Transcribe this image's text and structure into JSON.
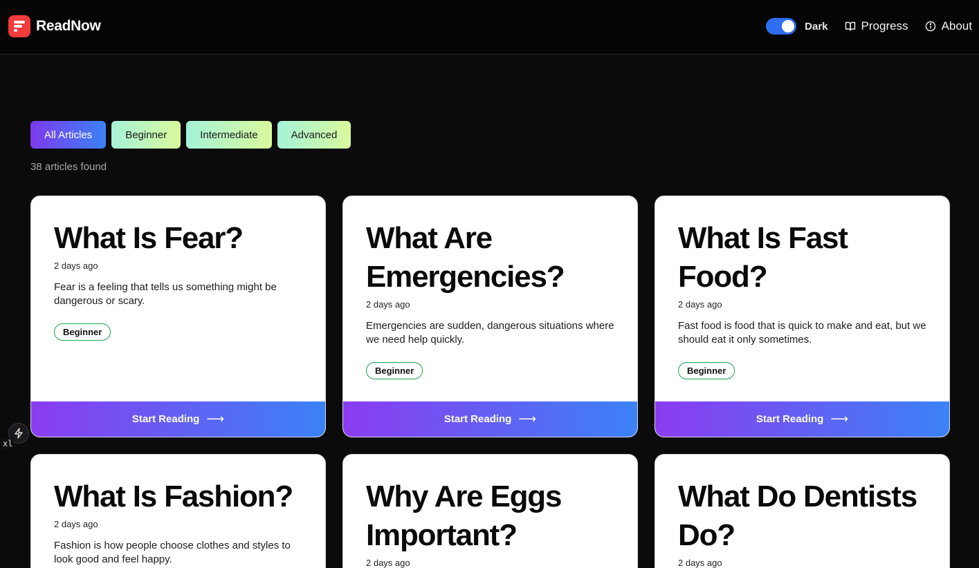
{
  "header": {
    "brand": "ReadNow",
    "theme_toggle_label": "Dark",
    "nav": {
      "progress": "Progress",
      "about": "About"
    }
  },
  "filters": [
    "All Articles",
    "Beginner",
    "Intermediate",
    "Advanced"
  ],
  "active_filter": "All Articles",
  "results_count": "38 articles found",
  "cards": [
    {
      "title": "What Is Fear?",
      "date": "2 days ago",
      "description": "Fear is a feeling that tells us something might be dangerous or scary.",
      "level": "Beginner",
      "cta": "Start Reading"
    },
    {
      "title": "What Are Emergencies?",
      "date": "2 days ago",
      "description": "Emergencies are sudden, dangerous situations where we need help quickly.",
      "level": "Beginner",
      "cta": "Start Reading"
    },
    {
      "title": "What Is Fast Food?",
      "date": "2 days ago",
      "description": "Fast food is food that is quick to make and eat, but we should eat it only sometimes.",
      "level": "Beginner",
      "cta": "Start Reading"
    },
    {
      "title": "What Is Fashion?",
      "date": "2 days ago",
      "description": "Fashion is how people choose clothes and styles to look good and feel happy."
    },
    {
      "title": "Why Are Eggs Important?",
      "date": "2 days ago"
    },
    {
      "title": "What Do Dentists Do?",
      "date": "2 days ago"
    }
  ],
  "dev_indicator": "xl",
  "colors": {
    "background": "#0b0b0c",
    "brand": "#f23b3b",
    "toggle": "#2f6df0",
    "cta_gradient_start": "#8b3cf0",
    "cta_gradient_end": "#3b82f6",
    "badge_border": "#16a34a"
  },
  "icons": {
    "logo": "readnow-logo-icon",
    "progress": "book-open-icon",
    "about": "info-icon",
    "cta": "arrow-right-icon",
    "dev": "lightning-icon"
  }
}
